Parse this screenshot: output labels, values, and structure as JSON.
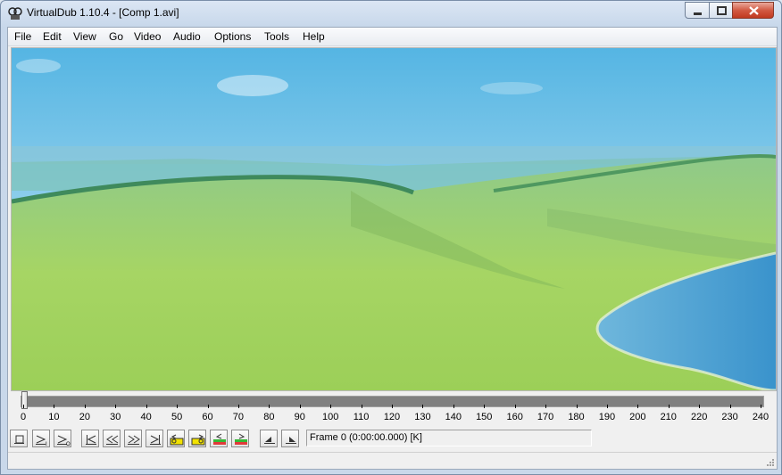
{
  "window": {
    "title": "VirtualDub 1.10.4 - [Comp 1.avi]"
  },
  "menu": [
    "File",
    "Edit",
    "View",
    "Go",
    "Video",
    "Audio",
    "Options",
    "Tools",
    "Help"
  ],
  "timeline": {
    "position_frame": 0,
    "ticks": [
      "0",
      "10",
      "20",
      "30",
      "40",
      "50",
      "60",
      "70",
      "80",
      "90",
      "100",
      "110",
      "120",
      "130",
      "140",
      "150",
      "160",
      "170",
      "180",
      "190",
      "200",
      "210",
      "220",
      "230",
      "240"
    ]
  },
  "toolbar": {
    "buttons": [
      "stop-icon",
      "play-input-icon",
      "play-output-icon",
      "go-start-icon",
      "prev-frame-icon",
      "next-frame-icon",
      "go-end-icon",
      "prev-keyframe-icon",
      "next-keyframe-icon",
      "prev-scene-icon",
      "next-scene-icon",
      "mark-in-icon",
      "mark-out-icon"
    ]
  },
  "status": {
    "frame_text": "Frame 0 (0:00:00.000) [K]"
  },
  "colors": {
    "sky": "#a9d9ee",
    "hills": "#9fd06a",
    "lake": "#4a9fd1"
  }
}
